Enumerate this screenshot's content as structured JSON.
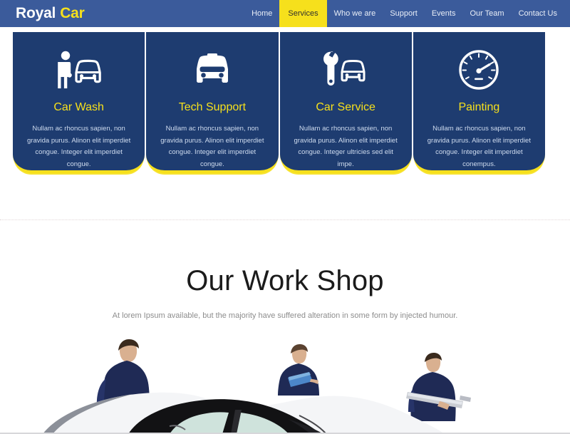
{
  "header": {
    "brand": {
      "first": "Royal",
      "second": "Car"
    },
    "nav": [
      {
        "label": "Home",
        "active": false
      },
      {
        "label": "Services",
        "active": true
      },
      {
        "label": "Who we are",
        "active": false
      },
      {
        "label": "Support",
        "active": false
      },
      {
        "label": "Events",
        "active": false
      },
      {
        "label": "Our Team",
        "active": false
      },
      {
        "label": "Contact Us",
        "active": false
      }
    ]
  },
  "services": [
    {
      "icon": "person-washing-car-icon",
      "title": "Car Wash",
      "text": "Nullam ac rhoncus sapien, non gravida purus. Alinon elit imperdiet congue. Integer elit imperdiet congue."
    },
    {
      "icon": "taxi-car-front-icon",
      "title": "Tech Support",
      "text": "Nullam ac rhoncus sapien, non gravida purus. Alinon elit imperdiet congue. Integer elit imperdiet congue."
    },
    {
      "icon": "wrench-car-icon",
      "title": "Car Service",
      "text": "Nullam ac rhoncus sapien, non gravida purus. Alinon elit imperdiet congue. Integer ultricies sed elit impe."
    },
    {
      "icon": "speedometer-gauge-icon",
      "title": "Painting",
      "text": "Nullam ac rhoncus sapien, non gravida purus. Alinon elit imperdiet congue. Integer elit imperdiet conempus."
    }
  ],
  "workshop": {
    "title": "Our Work Shop",
    "subtitle": "At lorem Ipsum available, but the majority have suffered alteration in some form by injected humour.",
    "photo_alt": "three-mechanics-inspecting-car-photo"
  },
  "colors": {
    "header_blue": "#3b5b9b",
    "card_navy": "#1e3c70",
    "accent_yellow": "#f6e01c",
    "heading_dark": "#1b1b1b",
    "muted_grey": "#8d8d8d"
  }
}
